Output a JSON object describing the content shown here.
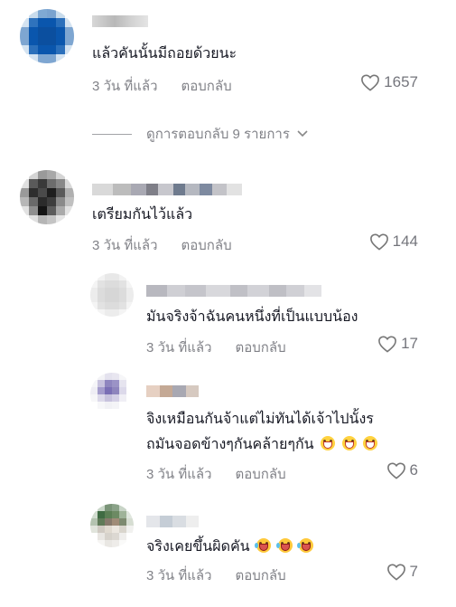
{
  "comments": [
    {
      "text": "แล้วคันนั้นมีถอยด้วยนะ",
      "time": "3 วัน ที่แล้ว",
      "reply": "ตอบกลับ",
      "likes": "1657",
      "avatar_colors": [
        "#ffffff",
        "#c9dcec",
        "#7fa9d3",
        "#7aa3cf",
        "#c9dcec",
        "#ffffff",
        "#d4e3f1",
        "#2f73bd",
        "#0a56ad",
        "#0a56ad",
        "#2c70bb",
        "#d4e3f1",
        "#7ea6d1",
        "#0a56ad",
        "#0b4f9f",
        "#0b4f9f",
        "#0a56ad",
        "#7ea6d1",
        "#7ea6d1",
        "#0a56ad",
        "#0b4f9f",
        "#0b4f9f",
        "#0a56ad",
        "#7ea6d1",
        "#d4e3f1",
        "#2c70bb",
        "#0a56ad",
        "#0a56ad",
        "#2c70bb",
        "#d4e3f1",
        "#ffffff",
        "#d4e3f1",
        "#7ea6d1",
        "#7ea6d1",
        "#d4e3f1",
        "#ffffff"
      ]
    },
    {
      "text": "เตรียมกันไว้แล้ว",
      "time": "3 วัน ที่แล้ว",
      "reply": "ตอบกลับ",
      "likes": "144",
      "avatar_colors": [
        "#ffffff",
        "#d5d5d5",
        "#9a9a9a",
        "#a8a8a8",
        "#d5d5d5",
        "#ffffff",
        "#e0e0e0",
        "#5a5a5a",
        "#3a3a3a",
        "#6d6d6d",
        "#888888",
        "#d8d8d8",
        "#9a9a9a",
        "#2e2e2e",
        "#4a4a4a",
        "#1e1e1e",
        "#5a5a5a",
        "#b0b0b0",
        "#b7b7b7",
        "#6a6a6a",
        "#2b2b2b",
        "#3d3d3d",
        "#8a8a8a",
        "#c0c0c0",
        "#e2e2e2",
        "#8f8f8f",
        "#141414",
        "#5c5c5c",
        "#aaaaaa",
        "#e2e2e2",
        "#ffffff",
        "#e0e0e0",
        "#b5b5b5",
        "#c4c4c4",
        "#e5e5e5",
        "#ffffff"
      ]
    }
  ],
  "view_replies": "ดูการตอบกลับ 9 รายการ",
  "replies": [
    {
      "text": "มันจริงจ้าฉันคนหนึ่งที่เป็นแบบน้อง",
      "time": "3 วัน ที่แล้ว",
      "reply": "ตอบกลับ",
      "likes": "17",
      "avatar_colors": [
        "#ffffff",
        "#f2f2f2",
        "#e8e8e8",
        "#e8e8e8",
        "#f2f2f2",
        "#ffffff",
        "#f4f4f4",
        "#e2e2e2",
        "#dcdcdc",
        "#dcdcdc",
        "#e2e2e2",
        "#f4f4f4",
        "#ececec",
        "#dcdcdc",
        "#d6d6d6",
        "#d6d6d6",
        "#dcdcdc",
        "#ececec",
        "#ececec",
        "#dcdcdc",
        "#d6d6d6",
        "#d6d6d6",
        "#dcdcdc",
        "#ececec",
        "#f4f4f4",
        "#e2e2e2",
        "#dcdcdc",
        "#dcdcdc",
        "#e2e2e2",
        "#f4f4f4",
        "#ffffff",
        "#f4f4f4",
        "#ececec",
        "#ececec",
        "#f4f4f4",
        "#ffffff"
      ]
    },
    {
      "text_line1": "จิงเหมือนกันจ้าแต่ไม่ทันได้เจ้าไปนั้งร",
      "text_line2": "ถมันจอดข้างๆกันคล้ายๆกัน",
      "time": "3 วัน ที่แล้ว",
      "reply": "ตอบกลับ",
      "likes": "6",
      "emoji": "grinning-face-emoji",
      "avatar_colors": [
        "#ffffff",
        "#f3f3f6",
        "#e4e2ee",
        "#e8e6f0",
        "#f6f6f8",
        "#ffffff",
        "#f5f5f8",
        "#c8c3de",
        "#8f86bf",
        "#9b93c6",
        "#e6e4ef",
        "#ffffff",
        "#eeedf4",
        "#a49ccc",
        "#7a6fb5",
        "#8e85bd",
        "#dcd9ea",
        "#ffffff",
        "#f6f6f8",
        "#dcd9ea",
        "#c7c2dd",
        "#d4d0e6",
        "#f0eff5",
        "#ffffff",
        "#ffffff",
        "#f7f7f9",
        "#f1f1f5",
        "#f4f4f7",
        "#ffffff",
        "#ffffff",
        "#ffffff",
        "#ffffff",
        "#ffffff",
        "#ffffff",
        "#ffffff",
        "#ffffff"
      ]
    },
    {
      "text": "จริงเคยขึ้นผิดคัน",
      "time": "3 วัน ที่แล้ว",
      "reply": "ตอบกลับ",
      "likes": "7",
      "emoji": "laughing-crying-face-emoji",
      "avatar_colors": [
        "#ffffff",
        "#c9d6c8",
        "#7a9478",
        "#8aa288",
        "#c8d4c7",
        "#ffffff",
        "#d1dccf",
        "#3f6b43",
        "#5b7f55",
        "#6c8a63",
        "#9fb399",
        "#e0e6de",
        "#b4c3b0",
        "#5f7a58",
        "#86796c",
        "#a08c78",
        "#7d8a70",
        "#d6ddd2",
        "#e1e4dc",
        "#cfcac2",
        "#e0dad0",
        "#ece7e0",
        "#d9d5cd",
        "#f1f1ef",
        "#ffffff",
        "#e8e6e2",
        "#d6d2cb",
        "#dcd8d2",
        "#efeeec",
        "#ffffff",
        "#ffffff",
        "#f6f5f3",
        "#e9e7e3",
        "#eeece9",
        "#fafaf9",
        "#ffffff"
      ]
    }
  ],
  "colors": {
    "text": "#161823",
    "meta": "#8a8b91",
    "emoji": "#ffd23f"
  }
}
